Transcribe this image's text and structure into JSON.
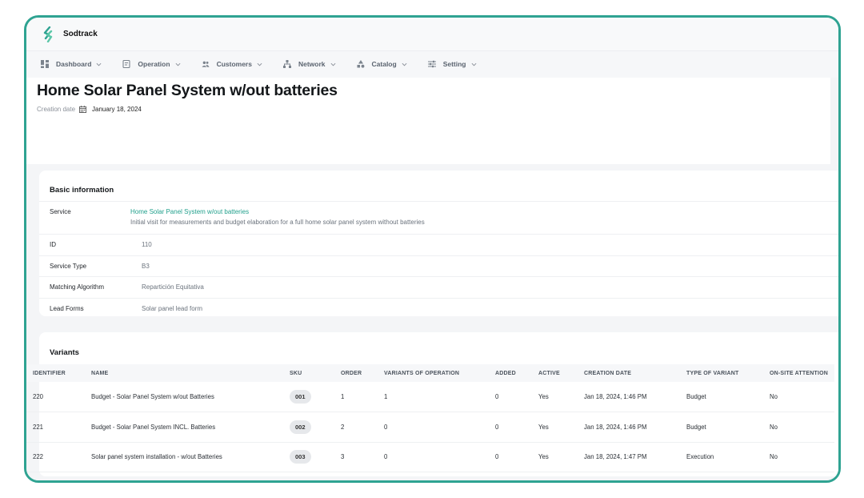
{
  "app": {
    "name": "Sodtrack",
    "brand_color": "#2fa392"
  },
  "nav": [
    {
      "label": "Dashboard",
      "icon": "dashboard-icon"
    },
    {
      "label": "Operation",
      "icon": "document-icon"
    },
    {
      "label": "Customers",
      "icon": "users-icon"
    },
    {
      "label": "Network",
      "icon": "network-icon"
    },
    {
      "label": "Catalog",
      "icon": "shapes-icon"
    },
    {
      "label": "Setting",
      "icon": "sliders-icon"
    }
  ],
  "page": {
    "title": "Home Solar Panel System w/out batteries",
    "creation_label": "Creation date",
    "creation_value": "January 18, 2024"
  },
  "basic": {
    "title": "Basic information",
    "service_label": "Service",
    "service_link": "Home Solar Panel System w/out batteries",
    "service_desc": "Initial visit for measurements and budget elaboration for a full home solar panel system without batteries",
    "rows": [
      {
        "label": "ID",
        "value": "110"
      },
      {
        "label": "Service Type",
        "value": "B3"
      },
      {
        "label": "Matching Algorithm",
        "value": "Repartición Equitativa"
      },
      {
        "label": "Lead Forms",
        "value": "Solar panel lead form"
      }
    ]
  },
  "variants": {
    "title": "Variants",
    "columns": [
      "IDENTIFIER",
      "NAME",
      "SKU",
      "ORDER",
      "VARIANTS OF OPERATION",
      "ADDED",
      "ACTIVE",
      "CREATION DATE",
      "TYPE OF VARIANT",
      "ON-SITE ATTENTION"
    ],
    "rows": [
      [
        "220",
        "Budget - Solar Panel System w/out Batteries",
        "001",
        "1",
        "1",
        "0",
        "Yes",
        "Jan 18, 2024, 1:46 PM",
        "Budget",
        "No"
      ],
      [
        "221",
        "Budget - Solar Panel System INCL. Batteries",
        "002",
        "2",
        "0",
        "0",
        "Yes",
        "Jan 18, 2024, 1:46 PM",
        "Budget",
        "No"
      ],
      [
        "222",
        "Solar panel system installation - w/out Batteries",
        "003",
        "3",
        "0",
        "0",
        "Yes",
        "Jan 18, 2024, 1:47 PM",
        "Execution",
        "No"
      ]
    ]
  }
}
